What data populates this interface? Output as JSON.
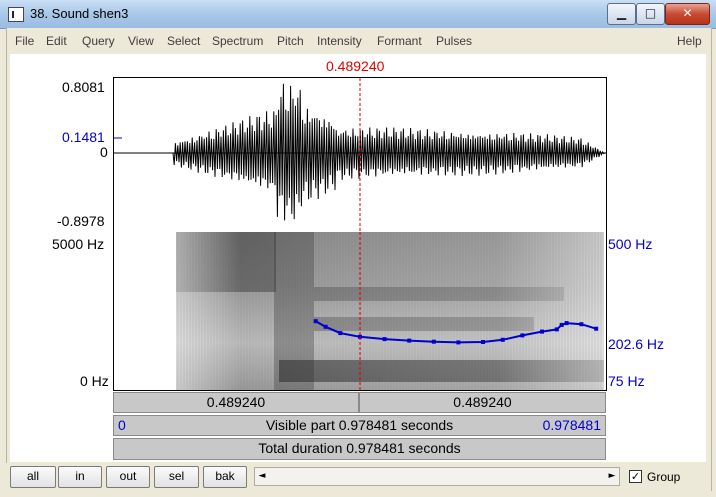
{
  "window": {
    "title": "38. Sound shen3",
    "controls": {
      "minimize": "▁",
      "maximize": "□",
      "close": "✕"
    }
  },
  "menu": [
    "File",
    "Edit",
    "Query",
    "View",
    "Select",
    "Spectrum",
    "Pitch",
    "Intensity",
    "Formant",
    "Pulses",
    "Help"
  ],
  "cursor": {
    "time_label": "0.489240",
    "time_fraction": 0.5
  },
  "waveform": {
    "ymax_label": "0.8081",
    "cursor_value_label": "0.1481",
    "zero_label": "0",
    "ymin_label": "-0.8978"
  },
  "spectrogram": {
    "top_freq_label": "5000 Hz",
    "bottom_freq_label": "0 Hz",
    "pitch_top_label": "500 Hz",
    "pitch_value_label": "202.6 Hz",
    "pitch_bottom_label": "75 Hz"
  },
  "pitch_track": {
    "range_hz": [
      75,
      500
    ],
    "points": [
      [
        0.41,
        260
      ],
      [
        0.43,
        245
      ],
      [
        0.46,
        228
      ],
      [
        0.5,
        218
      ],
      [
        0.55,
        212
      ],
      [
        0.6,
        208
      ],
      [
        0.65,
        205
      ],
      [
        0.7,
        203
      ],
      [
        0.75,
        204
      ],
      [
        0.79,
        210
      ],
      [
        0.83,
        222
      ],
      [
        0.87,
        232
      ],
      [
        0.9,
        238
      ],
      [
        0.91,
        250
      ],
      [
        0.92,
        255
      ],
      [
        0.95,
        252
      ],
      [
        0.98,
        240
      ]
    ]
  },
  "time_bars": {
    "left_segment": "0.489240",
    "right_segment": "0.489240",
    "visible_start": "0",
    "visible_label": "Visible part 0.978481 seconds",
    "visible_end": "0.978481",
    "total_label": "Total duration 0.978481 seconds"
  },
  "toolbar": {
    "buttons": [
      "all",
      "in",
      "out",
      "sel",
      "bak"
    ],
    "scroll_left": "◄",
    "scroll_right": "►",
    "group_label": "Group",
    "group_checked": true
  },
  "colors": {
    "cursor": "#e00000",
    "pitch": "#0000d0",
    "frame": "#ECE9D8"
  }
}
